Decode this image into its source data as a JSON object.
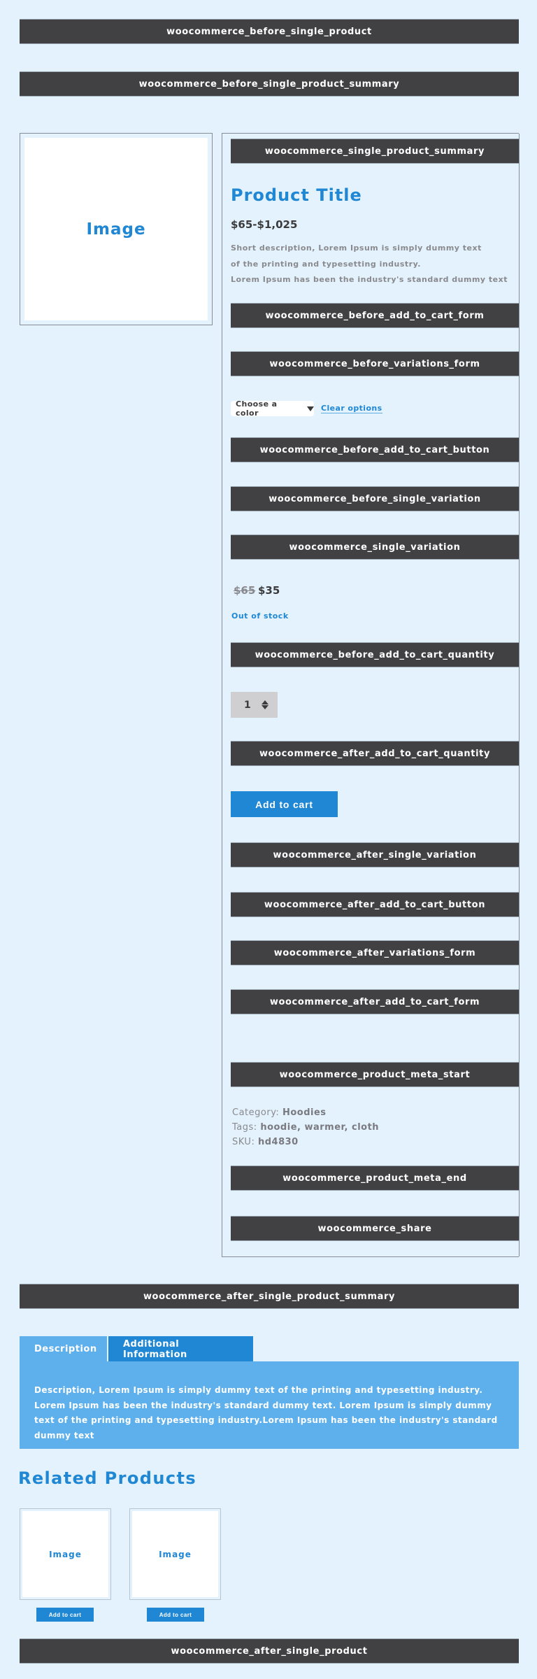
{
  "hooks": {
    "before_single_product": "woocommerce_before_single_product",
    "before_single_product_summary": "woocommerce_before_single_product_summary",
    "single_product_summary": "woocommerce_single_product_summary",
    "before_add_to_cart_form": "woocommerce_before_add_to_cart_form",
    "before_variations_form": "woocommerce_before_variations_form",
    "before_add_to_cart_button": "woocommerce_before_add_to_cart_button",
    "before_single_variation": "woocommerce_before_single_variation",
    "single_variation": "woocommerce_single_variation",
    "before_add_to_cart_quantity": "woocommerce_before_add_to_cart_quantity",
    "after_add_to_cart_quantity": "woocommerce_after_add_to_cart_quantity",
    "after_single_variation": "woocommerce_after_single_variation",
    "after_add_to_cart_button": "woocommerce_after_add_to_cart_button",
    "after_variations_form": "woocommerce_after_variations_form",
    "after_add_to_cart_form": "woocommerce_after_add_to_cart_form",
    "product_meta_start": "woocommerce_product_meta_start",
    "product_meta_end": "woocommerce_product_meta_end",
    "share": "woocommerce_share",
    "after_single_product_summary": "woocommerce_after_single_product_summary",
    "after_single_product": "woocommerce_after_single_product"
  },
  "gallery": {
    "image_placeholder": "Image"
  },
  "product": {
    "title": "Product Title",
    "price_range": "$65-$1,025",
    "short_description": [
      "Short description, Lorem Ipsum is simply dummy text",
      "of the printing and typesetting industry.",
      "Lorem Ipsum has been the industry's standard dummy text"
    ],
    "variation_select": {
      "selected": "Choose a color",
      "icon": "caret-down-icon"
    },
    "clear_options": "Clear options",
    "variation_price": {
      "regular": "$65",
      "sale": "$35"
    },
    "stock_status": "Out of stock",
    "quantity": "1",
    "add_to_cart": "Add to cart",
    "meta": {
      "category_label": "Category:",
      "category_value": "Hoodies",
      "tags_label": "Tags:",
      "tags_value": "hoodie, warmer, cloth",
      "sku_label": "SKU:",
      "sku_value": "hd4830"
    }
  },
  "tabs": {
    "items": [
      {
        "label": "Description",
        "active": true
      },
      {
        "label": "Additional Information",
        "active": false
      }
    ],
    "panel_text": "Description, Lorem Ipsum is simply dummy text of the printing and typesetting industry. Lorem Ipsum has been the industry's standard dummy text. Lorem Ipsum is simply dummy text of the printing and typesetting industry.Lorem Ipsum has been the industry's standard dummy text"
  },
  "related": {
    "title": "Related Products",
    "items": [
      {
        "image": "Image",
        "button": "Add to cart"
      },
      {
        "image": "Image",
        "button": "Add to cart"
      }
    ]
  },
  "colors": {
    "background": "#e3f2fc",
    "hook_bar": "#414143",
    "accent": "#1f87d4",
    "tab_light": "#5eb0ec",
    "muted_text": "#8a8a8e",
    "dark_text": "#3b3b3d"
  }
}
